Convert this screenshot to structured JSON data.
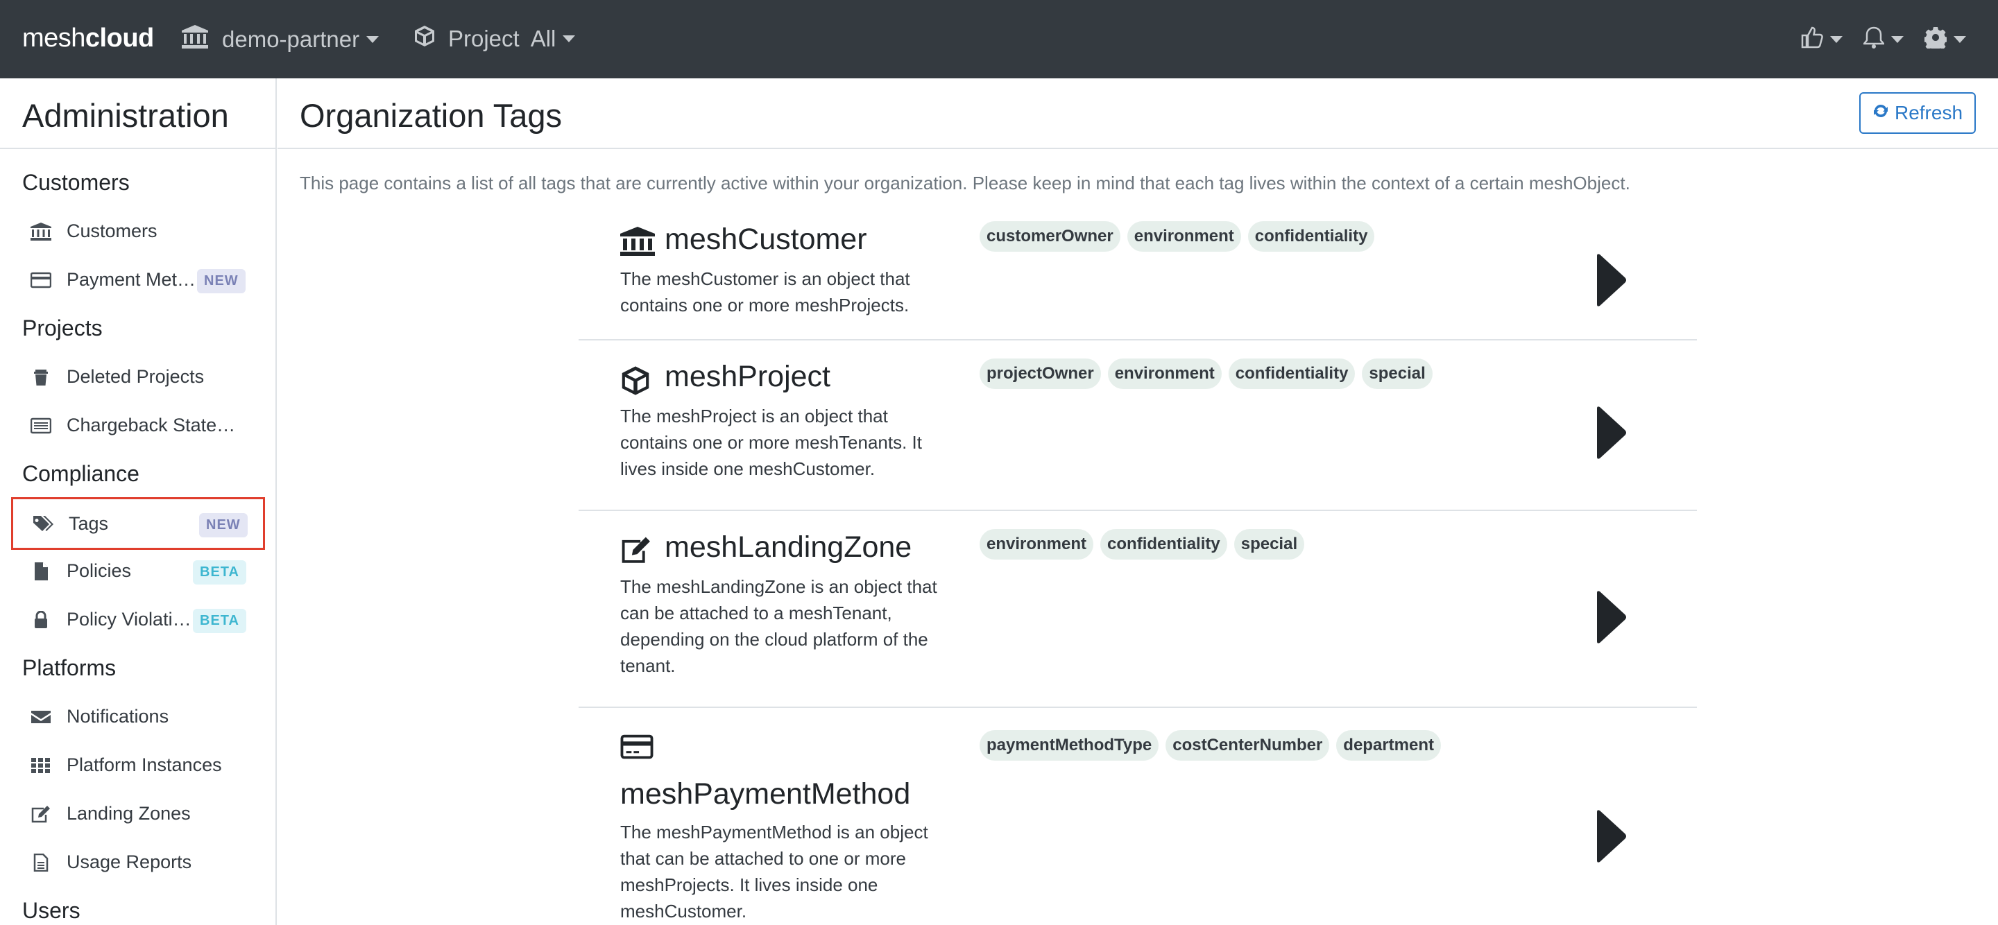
{
  "navbar": {
    "brand_light": "mesh",
    "brand_bold": "cloud",
    "customer_label": "demo-partner",
    "project_label": "Project",
    "project_value": "All",
    "feedback_icon": "thumbs-up-icon",
    "notifications_icon": "bell-icon",
    "settings_icon": "gear-icon"
  },
  "sidebar": {
    "title": "Administration",
    "sections": {
      "customers": {
        "title": "Customers",
        "items": [
          {
            "label": "Customers",
            "icon": "bank-icon"
          },
          {
            "label": "Payment Met…",
            "icon": "credit-card-icon",
            "badge": "NEW"
          }
        ]
      },
      "projects": {
        "title": "Projects",
        "items": [
          {
            "label": "Deleted Projects",
            "icon": "trash-icon"
          },
          {
            "label": "Chargeback State…",
            "icon": "statement-icon"
          }
        ]
      },
      "compliance": {
        "title": "Compliance",
        "items": [
          {
            "label": "Tags",
            "icon": "tags-icon",
            "badge": "NEW"
          },
          {
            "label": "Policies",
            "icon": "file-icon",
            "badge": "BETA"
          },
          {
            "label": "Policy Violati…",
            "icon": "lock-icon",
            "badge": "BETA"
          }
        ]
      },
      "platforms": {
        "title": "Platforms",
        "items": [
          {
            "label": "Notifications",
            "icon": "envelope-icon"
          },
          {
            "label": "Platform Instances",
            "icon": "grid-icon"
          },
          {
            "label": "Landing Zones",
            "icon": "edit-icon"
          },
          {
            "label": "Usage Reports",
            "icon": "report-icon"
          }
        ]
      },
      "users": {
        "title": "Users"
      }
    }
  },
  "main": {
    "title": "Organization Tags",
    "refresh_label": "Refresh",
    "intro": "This page contains a list of all tags that are currently active within your organization. Please keep in mind that each tag lives within the context of a certain meshObject.",
    "objects": [
      {
        "name": "meshCustomer",
        "icon": "bank-icon",
        "description": "The meshCustomer is an object that contains one or more meshProjects.",
        "tags": [
          "customerOwner",
          "environment",
          "confidentiality"
        ]
      },
      {
        "name": "meshProject",
        "icon": "cube-icon",
        "description": "The meshProject is an object that contains one or more meshTenants. It lives inside one meshCustomer.",
        "tags": [
          "projectOwner",
          "environment",
          "confidentiality",
          "special"
        ]
      },
      {
        "name": "meshLandingZone",
        "icon": "edit-icon",
        "description": "The meshLandingZone is an object that can be attached to a meshTenant, depending on the cloud platform of the tenant.",
        "tags": [
          "environment",
          "confidentiality",
          "special"
        ]
      },
      {
        "name": "meshPaymentMethod",
        "icon": "credit-card-icon",
        "description": "The meshPaymentMethod is an object that can be attached to one or more meshProjects. It lives inside one meshCustomer.",
        "tags": [
          "paymentMethodType",
          "costCenterNumber",
          "department"
        ]
      }
    ]
  },
  "colors": {
    "navbar_bg": "#343a40",
    "accent_blue": "#2a78c7",
    "highlight_red": "#e03e2d",
    "tag_bg": "#e6efeb"
  }
}
